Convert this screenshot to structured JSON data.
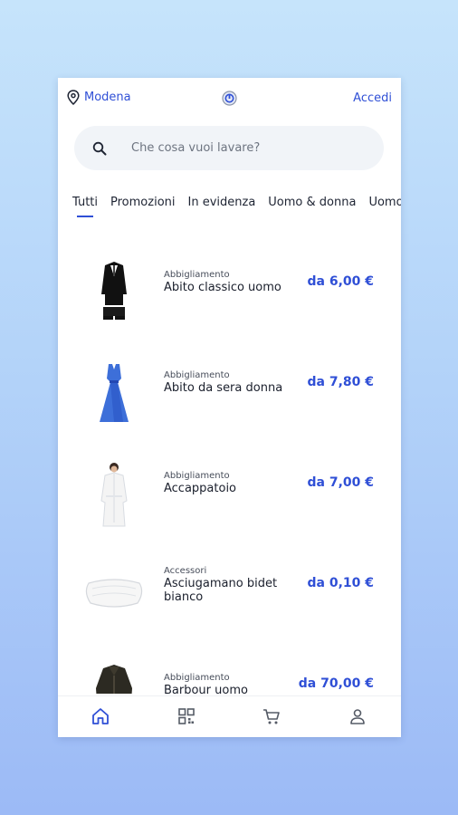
{
  "header": {
    "location": "Modena",
    "login_label": "Accedi",
    "logo_icon": "brand-logo-icon"
  },
  "search": {
    "placeholder": "Che cosa vuoi lavare?",
    "value": ""
  },
  "tabs": [
    {
      "label": "Tutti",
      "active": true
    },
    {
      "label": "Promozioni",
      "active": false
    },
    {
      "label": "In evidenza",
      "active": false
    },
    {
      "label": "Uomo & donna",
      "active": false
    },
    {
      "label": "Uomo",
      "active": false
    }
  ],
  "products": [
    {
      "category": "Abbigliamento",
      "name": "Abito classico uomo",
      "price": "da 6,00 €",
      "image": "suit"
    },
    {
      "category": "Abbigliamento",
      "name": "Abito da sera donna",
      "price": "da 7,80 €",
      "image": "dress"
    },
    {
      "category": "Abbigliamento",
      "name": "Accappatoio",
      "price": "da 7,00 €",
      "image": "bathrobe"
    },
    {
      "category": "Accessori",
      "name": "Asciugamano bidet bianco",
      "price": "da 0,10 €",
      "image": "towel"
    },
    {
      "category": "Abbigliamento",
      "name": "Barbour uomo",
      "price": "da 70,00 €",
      "image": "jacket"
    }
  ],
  "bottom_nav": [
    {
      "name": "home-icon",
      "active": true
    },
    {
      "name": "qr-code-icon",
      "active": false
    },
    {
      "name": "cart-icon",
      "active": false
    },
    {
      "name": "profile-icon",
      "active": false
    }
  ],
  "colors": {
    "accent": "#2f4fd6",
    "background_top": "#c6e4fb",
    "background_bottom": "#9cbaf6"
  }
}
